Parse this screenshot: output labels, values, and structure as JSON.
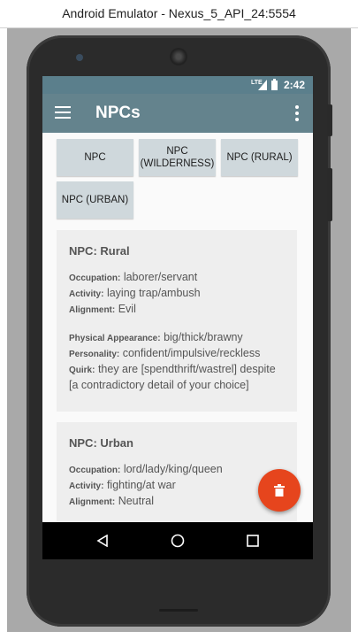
{
  "window": {
    "title": "Android Emulator - Nexus_5_API_24:5554"
  },
  "status_bar": {
    "network": "LTE",
    "time": "2:42"
  },
  "app_bar": {
    "title": "NPCs"
  },
  "buttons": [
    {
      "label": "NPC"
    },
    {
      "label": "NPC\n(WILDERNESS)"
    },
    {
      "label": "NPC (RURAL)"
    },
    {
      "label": "NPC (URBAN)"
    }
  ],
  "cards": [
    {
      "title": "NPC: Rural",
      "fields": [
        {
          "label": "Occupation:",
          "value": "laborer/servant"
        },
        {
          "label": "Activity:",
          "value": "laying trap/ambush"
        },
        {
          "label": "Alignment:",
          "value": "Evil"
        },
        {
          "label": "Physical Appearance:",
          "value": "big/thick/brawny"
        },
        {
          "label": "Personality:",
          "value": "confident/impulsive/reckless"
        },
        {
          "label": "Quirk:",
          "value": "they are [spendthrift/wastrel] despite [a contradictory detail of your choice]"
        }
      ]
    },
    {
      "title": "NPC: Urban",
      "fields": [
        {
          "label": "Occupation:",
          "value": "lord/lady/king/queen"
        },
        {
          "label": "Activity:",
          "value": "fighting/at war"
        },
        {
          "label": "Alignment:",
          "value": "Neutral"
        }
      ]
    }
  ],
  "fab": {
    "icon": "trash-icon"
  },
  "nav": {
    "icons": [
      "back-icon",
      "home-icon",
      "recents-icon"
    ]
  },
  "colors": {
    "appbar": "#64838d",
    "statusbar": "#5b7f8c",
    "fab": "#e6451d",
    "button": "#cfd8dc"
  }
}
